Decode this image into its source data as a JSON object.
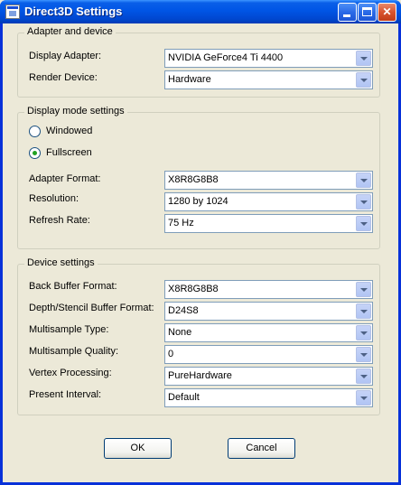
{
  "window": {
    "title": "Direct3D Settings"
  },
  "adapter_group": {
    "title": "Adapter and device",
    "display_adapter": {
      "label": "Display Adapter:",
      "value": "NVIDIA GeForce4 Ti 4400"
    },
    "render_device": {
      "label": "Render Device:",
      "value": "Hardware"
    }
  },
  "display_group": {
    "title": "Display mode settings",
    "windowed_label": "Windowed",
    "fullscreen_label": "Fullscreen",
    "selected_mode": "Fullscreen",
    "adapter_format": {
      "label": "Adapter Format:",
      "value": "X8R8G8B8"
    },
    "resolution": {
      "label": "Resolution:",
      "value": "1280 by 1024"
    },
    "refresh_rate": {
      "label": "Refresh Rate:",
      "value": "75 Hz"
    }
  },
  "device_group": {
    "title": "Device settings",
    "back_buffer_format": {
      "label": "Back Buffer Format:",
      "value": "X8R8G8B8"
    },
    "depth_stencil_format": {
      "label": "Depth/Stencil Buffer Format:",
      "value": "D24S8"
    },
    "multisample_type": {
      "label": "Multisample Type:",
      "value": "None"
    },
    "multisample_quality": {
      "label": "Multisample Quality:",
      "value": "0"
    },
    "vertex_processing": {
      "label": "Vertex Processing:",
      "value": "PureHardware"
    },
    "present_interval": {
      "label": "Present Interval:",
      "value": "Default"
    }
  },
  "buttons": {
    "ok": "OK",
    "cancel": "Cancel"
  },
  "icons": {
    "app": "direct3d-window-icon",
    "minimize": "minimize-icon",
    "maximize": "maximize-icon",
    "close": "close-icon",
    "dropdown": "chevron-down-icon"
  },
  "colors": {
    "titlebar": "#0055e5",
    "face": "#ece9d8",
    "field_border": "#7f9db9"
  }
}
